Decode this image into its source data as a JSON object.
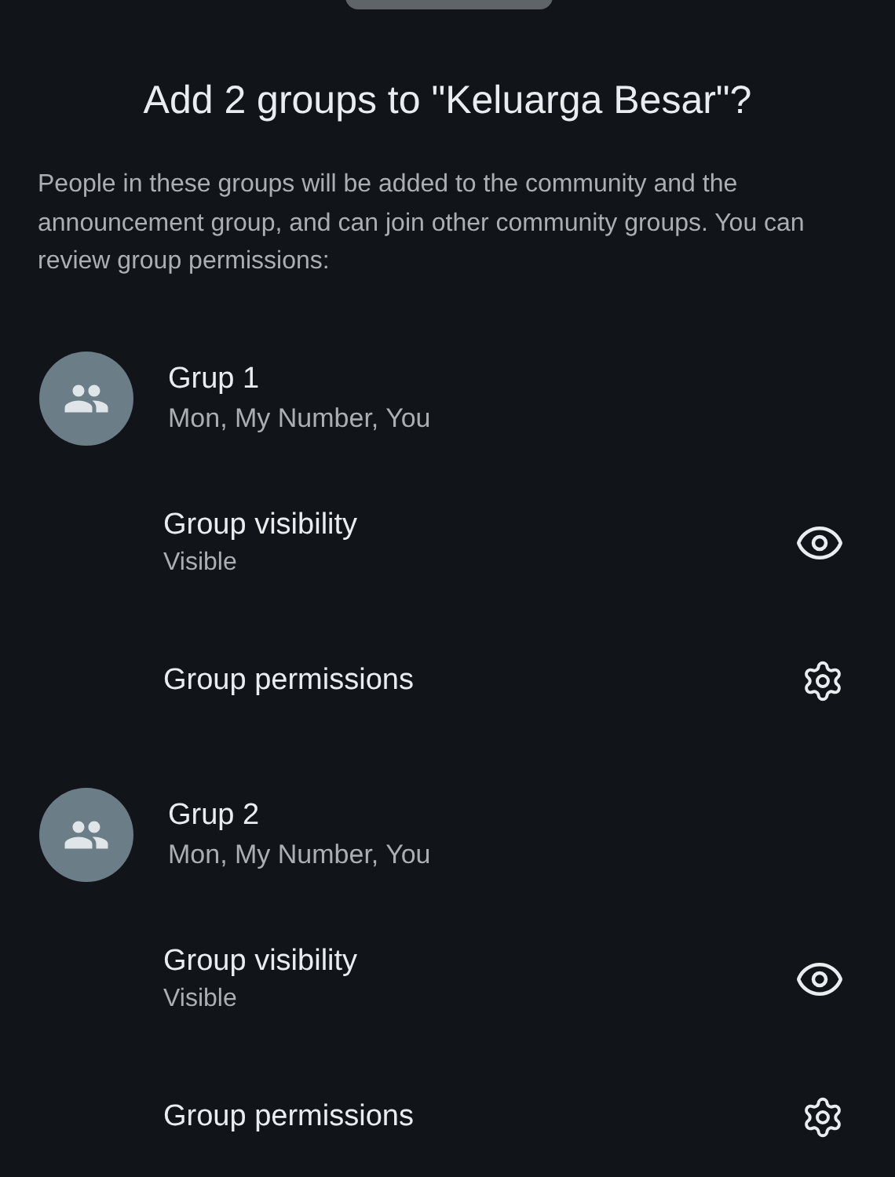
{
  "title": "Add 2 groups to \"Keluarga Besar\"?",
  "description": "People in these groups will be added to the community and the announcement group, and can join other community groups. You can review group permissions:",
  "groups": [
    {
      "name": "Grup 1",
      "members": "Mon, My Number, You",
      "settings": [
        {
          "kind": "visibility",
          "label": "Group visibility",
          "value": "Visible"
        },
        {
          "kind": "permissions",
          "label": "Group permissions"
        }
      ]
    },
    {
      "name": "Grup 2",
      "members": "Mon, My Number, You",
      "settings": [
        {
          "kind": "visibility",
          "label": "Group visibility",
          "value": "Visible"
        },
        {
          "kind": "permissions",
          "label": "Group permissions"
        }
      ]
    }
  ]
}
